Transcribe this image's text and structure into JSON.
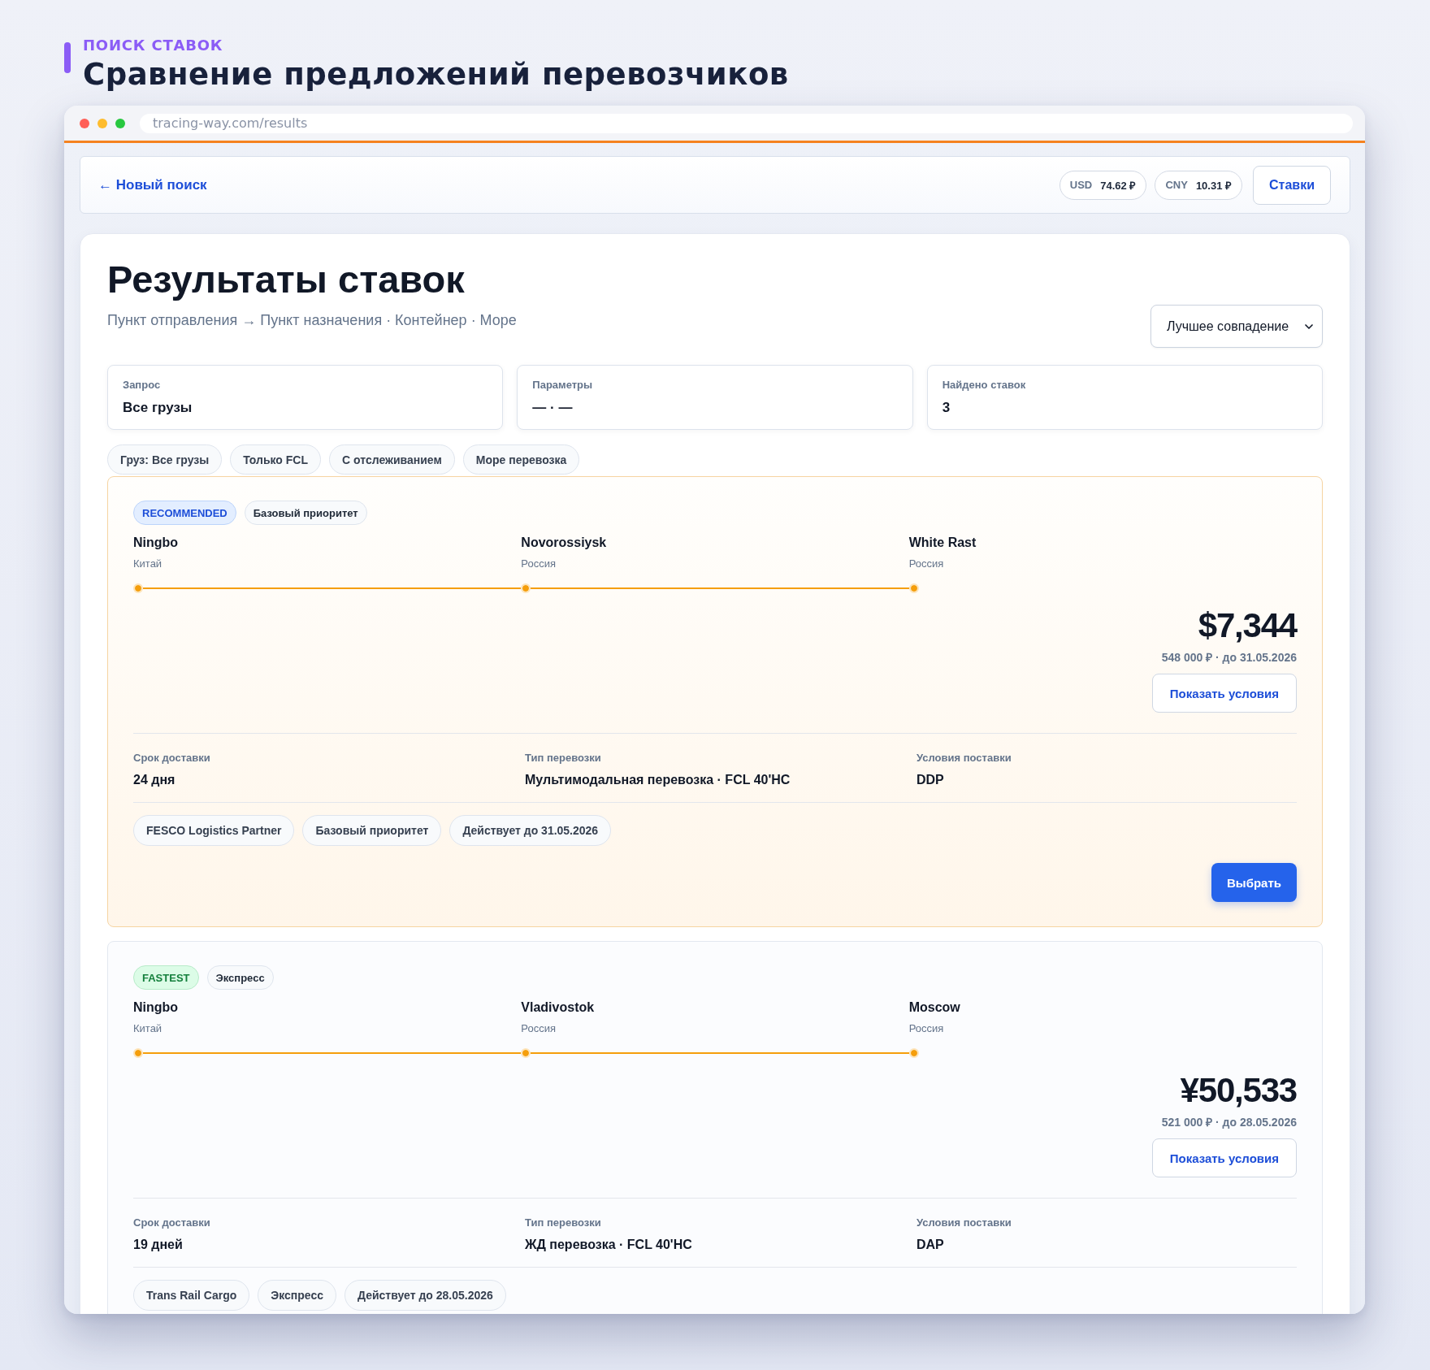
{
  "header": {
    "eyebrow": "ПОИСК СТАВОК",
    "title": "Сравнение предложений перевозчиков"
  },
  "browser": {
    "url": "tracing-way.com/results"
  },
  "nav": {
    "back_link": "← Новый поиск",
    "rates": [
      {
        "code": "USD",
        "value": "74.62 ₽"
      },
      {
        "code": "CNY",
        "value": "10.31 ₽"
      }
    ],
    "button": "Ставки"
  },
  "results": {
    "title": "Результаты ставок",
    "subtitle": "Пункт отправления → Пункт назначения · Контейнер · Море",
    "sort": "Лучшее совпадение",
    "summary": [
      {
        "label": "Запрос",
        "value": "Все грузы"
      },
      {
        "label": "Параметры",
        "value": "— · —"
      },
      {
        "label": "Найдено ставок",
        "value": "3"
      }
    ],
    "filters": [
      "Груз: Все грузы",
      "Только FCL",
      "С отслеживанием",
      "Море перевозка"
    ],
    "offers": [
      {
        "featured": true,
        "badges": [
          {
            "label": "RECOMMENDED",
            "kind": "recommended"
          },
          {
            "label": "Базовый приоритет",
            "kind": "neutral"
          }
        ],
        "route": [
          {
            "city": "Ningbo",
            "country": "Китай"
          },
          {
            "city": "Novorossiysk",
            "country": "Россия"
          },
          {
            "city": "White Rast",
            "country": "Россия"
          }
        ],
        "price": "$7,344",
        "price_note": "548 000 ₽ · до 31.05.2026",
        "terms_button": "Показать условия",
        "details": [
          {
            "label": "Срок доставки",
            "value": "24 дня"
          },
          {
            "label": "Тип перевозки",
            "value": "Мультимодальная перевозка · FCL 40'HC"
          },
          {
            "label": "Условия поставки",
            "value": "DDP"
          }
        ],
        "tags": [
          "FESCO Logistics Partner",
          "Базовый приоритет",
          "Действует до 31.05.2026"
        ],
        "select_button": "Выбрать"
      },
      {
        "featured": false,
        "badges": [
          {
            "label": "FASTEST",
            "kind": "fastest"
          },
          {
            "label": "Экспресс",
            "kind": "neutral"
          }
        ],
        "route": [
          {
            "city": "Ningbo",
            "country": "Китай"
          },
          {
            "city": "Vladivostok",
            "country": "Россия"
          },
          {
            "city": "Moscow",
            "country": "Россия"
          }
        ],
        "price": "¥50,533",
        "price_note": "521 000 ₽ · до 28.05.2026",
        "terms_button": "Показать условия",
        "details": [
          {
            "label": "Срок доставки",
            "value": "19 дней"
          },
          {
            "label": "Тип перевозки",
            "value": "ЖД перевозка · FCL 40'HC"
          },
          {
            "label": "Условия поставки",
            "value": "DAP"
          }
        ],
        "tags": [
          "Trans Rail Cargo",
          "Экспресс",
          "Действует до 28.05.2026"
        ]
      }
    ]
  }
}
